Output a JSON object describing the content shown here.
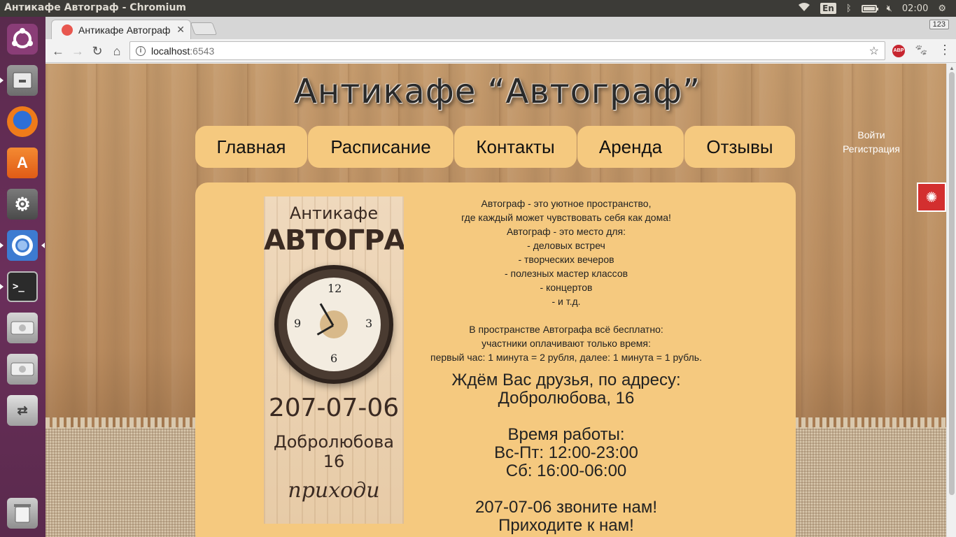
{
  "os": {
    "window_title": "Антикафе Автограф - Chromium",
    "lang": "En",
    "clock": "02:00"
  },
  "launcher": {
    "items": [
      "Ubuntu dash",
      "Files",
      "Firefox",
      "Ubuntu Software",
      "System Settings",
      "Chromium",
      "Terminal",
      "Disk",
      "Disk",
      "USB drive",
      "Trash"
    ]
  },
  "browser": {
    "tab_title": "Антикафе Автограф",
    "url_host": "localhost",
    "url_port": ":6543",
    "keyboard_badge": "123",
    "abp_label": "ABP"
  },
  "site": {
    "title": "Антикафе  “Автограф”",
    "nav": [
      "Главная",
      "Расписание",
      "Контакты",
      "Аренда",
      "Отзывы"
    ],
    "auth": {
      "login": "Войти",
      "register": "Регистрация"
    },
    "poster": {
      "line1": "Антикафе",
      "line2": "АВТОГРАФ",
      "phone": "207-07-06",
      "address": "Добролюбова 16",
      "signature": "приходи"
    },
    "intro": [
      "Автограф - это уютное пространство,",
      "где каждый может чувствовать себя как дома!",
      "Автограф - это место для:",
      "- деловых встреч",
      "- творческих вечеров",
      "- полезных мастер классов",
      "- концертов",
      "- и т.д."
    ],
    "pricing": [
      "В пространстве Автографа всё бесплатно:",
      "участники оплачивают только время:",
      "первый час: 1 минута = 2 рубля, далее: 1 минута = 1 рубль."
    ],
    "address": [
      "Ждём Вас друзья, по адресу:",
      "Добролюбова, 16"
    ],
    "hours": [
      "Время работы:",
      "Вс-Пт: 12:00-23:00",
      "Сб: 16:00-06:00"
    ],
    "call": [
      "207-07-06 звоните нам!",
      "Приходите к нам!"
    ]
  }
}
